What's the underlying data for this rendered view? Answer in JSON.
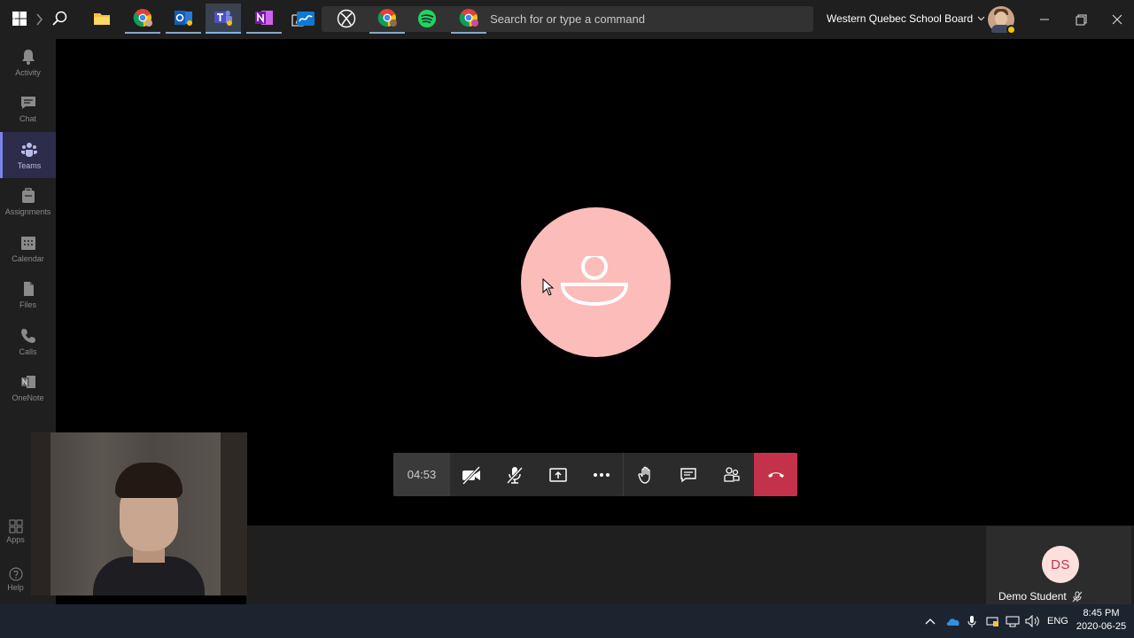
{
  "titlebar": {
    "search_placeholder": "Search for or type a command",
    "organization": "Western Quebec School Board"
  },
  "rail": {
    "items": [
      {
        "label": "Activity",
        "icon": "bell-icon"
      },
      {
        "label": "Chat",
        "icon": "chat-icon"
      },
      {
        "label": "Teams",
        "icon": "teams-icon",
        "active": true
      },
      {
        "label": "Assignments",
        "icon": "assignments-icon"
      },
      {
        "label": "Calendar",
        "icon": "calendar-icon"
      },
      {
        "label": "Files",
        "icon": "files-icon"
      },
      {
        "label": "Calls",
        "icon": "phone-icon"
      },
      {
        "label": "OneNote",
        "icon": "onenote-icon"
      }
    ],
    "apps_label": "Apps",
    "help_label": "Help"
  },
  "call": {
    "duration": "04:53",
    "avatar_color": "#fbbcba",
    "hangup_color": "#c4314b"
  },
  "participant": {
    "initials": "DS",
    "name": "Demo Student"
  },
  "taskbar": {
    "language": "ENG",
    "time": "8:45 PM",
    "date": "2020-06-25"
  }
}
